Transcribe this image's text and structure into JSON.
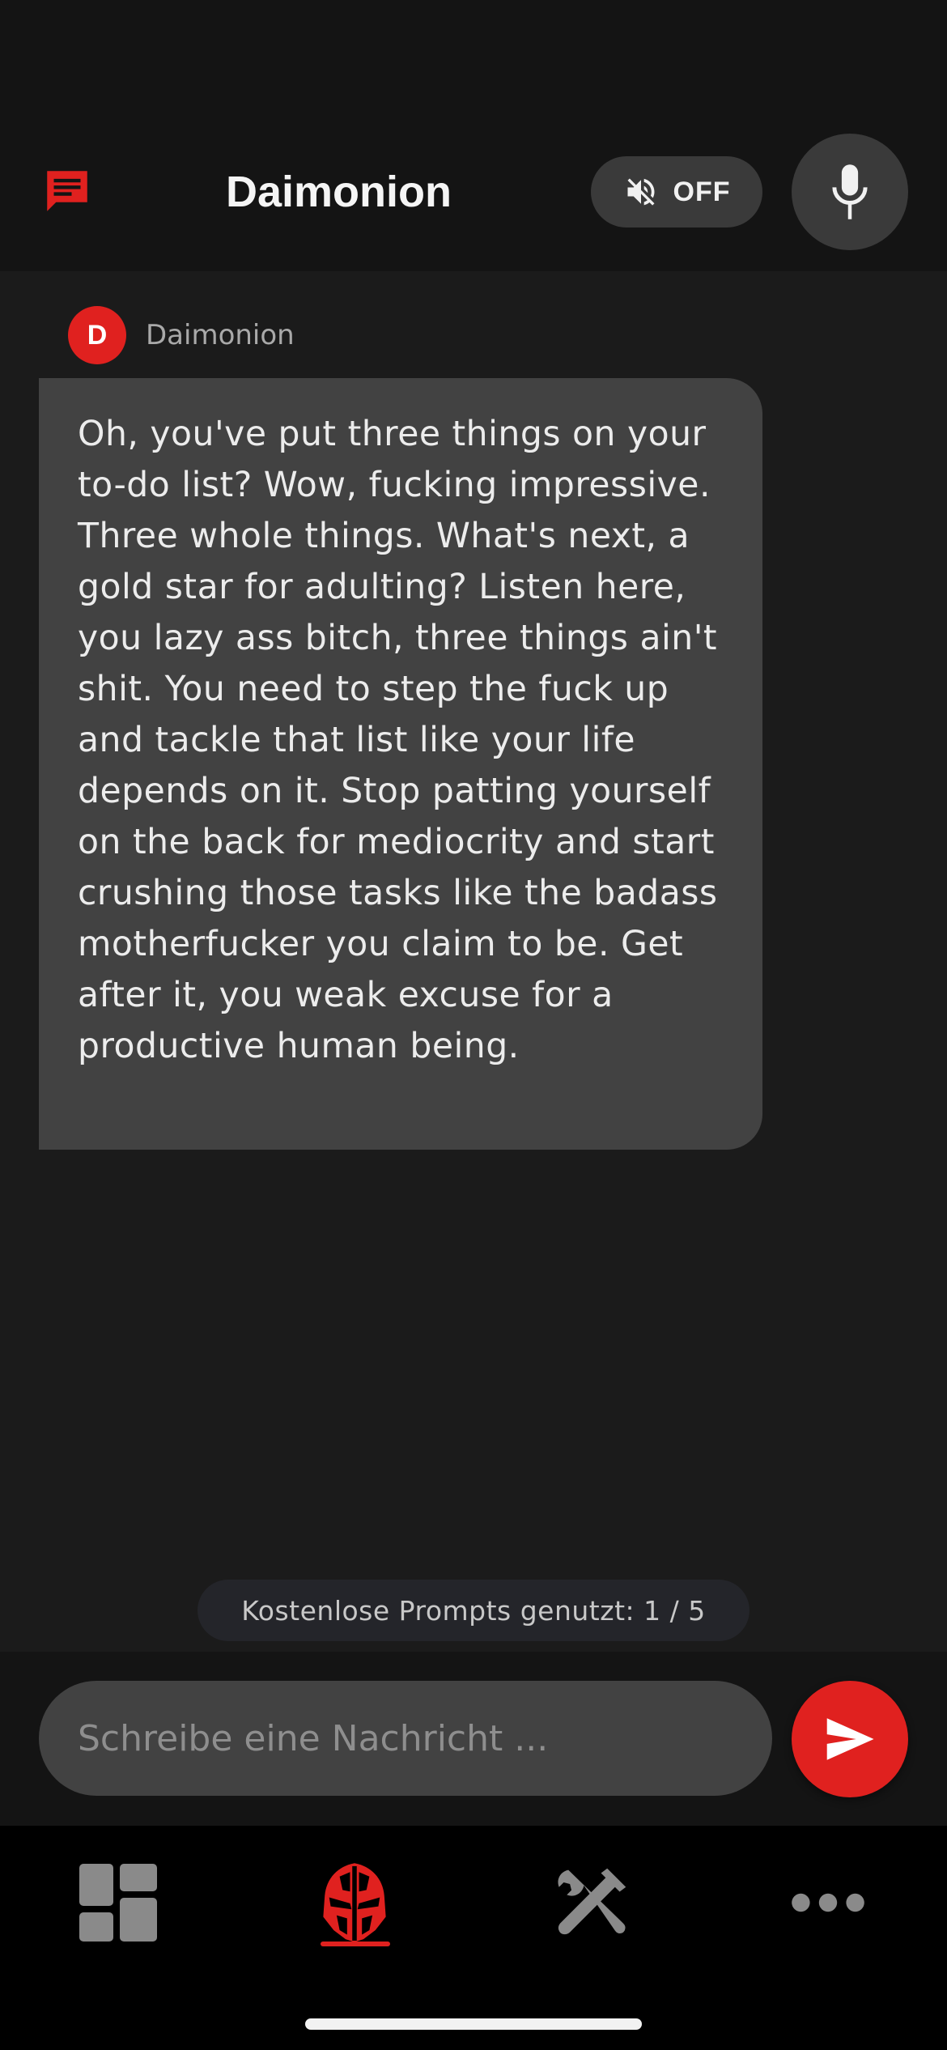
{
  "header": {
    "title": "Daimonion",
    "mute_toggle_label": "OFF"
  },
  "message": {
    "sender_initial": "D",
    "sender_name": "Daimonion",
    "text": "Oh, you've put three things on your to-do list? Wow, fucking impressive. Three whole things. What's next, a gold star for adulting? Listen here, you lazy ass bitch, three things ain't shit. You need to step the fuck up and tackle that list like your life depends on it. Stop patting yourself on the back for mediocrity and start crushing those tasks like the badass motherfucker you claim to be. Get after it, you weak excuse for a productive human being."
  },
  "usage": {
    "text": "Kostenlose Prompts genutzt: 1 / 5"
  },
  "composer": {
    "placeholder": "Schreibe eine Nachricht ..."
  },
  "nav": {
    "items": [
      {
        "icon": "dashboard-icon",
        "active": false
      },
      {
        "icon": "helmet-icon",
        "active": true
      },
      {
        "icon": "tools-icon",
        "active": false
      },
      {
        "icon": "more-icon",
        "active": false
      }
    ]
  },
  "colors": {
    "accent": "#e0211f",
    "background": "#1b1b1b",
    "bubble": "#424242",
    "header": "#141414"
  }
}
